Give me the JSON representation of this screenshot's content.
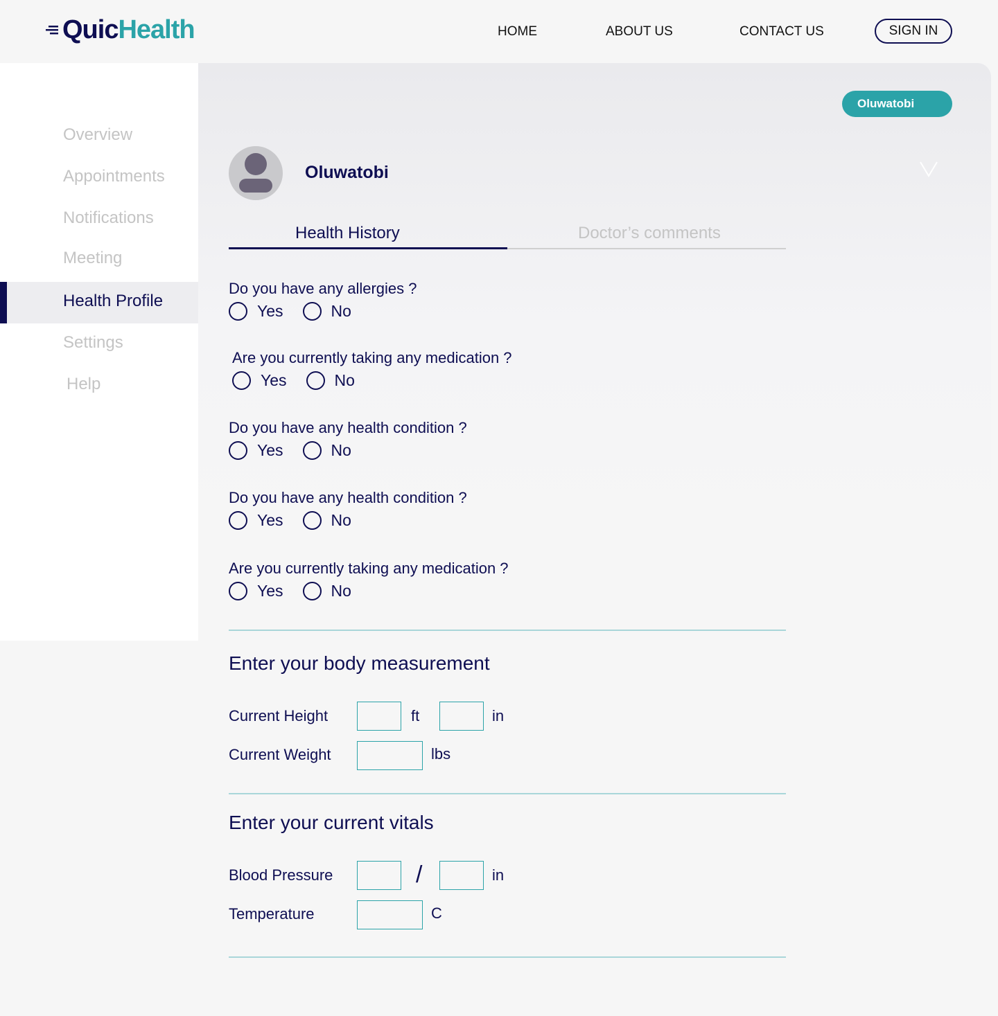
{
  "brand": {
    "quic": "Quic",
    "health": "Health"
  },
  "nav": {
    "home": "HOME",
    "about": "ABOUT US",
    "contact": "CONTACT US",
    "signin": "SIGN IN"
  },
  "sidebar": {
    "items": [
      "Overview",
      "Appointments",
      "Notifications",
      "Meeting",
      "Health Profile",
      "Settings",
      "Help"
    ],
    "active": "Health Profile"
  },
  "user": {
    "pill": "Oluwatobi",
    "name": "Oluwatobi"
  },
  "tabs": {
    "history": "Health History",
    "comments": "Doctor’s comments"
  },
  "questions": [
    {
      "text": "Do you have any allergies ?",
      "yes": "Yes",
      "no": "No"
    },
    {
      "text": "Are you currently taking any medication ?",
      "yes": "Yes",
      "no": "No"
    },
    {
      "text": "Do you have any health condition ?",
      "yes": "Yes",
      "no": "No"
    },
    {
      "text": "Do you have any health condition ?",
      "yes": "Yes",
      "no": "No"
    },
    {
      "text": "Are you currently taking any medication ?",
      "yes": "Yes",
      "no": "No"
    }
  ],
  "body_measurement": {
    "title": "Enter your body measurement",
    "height_label": "Current Height",
    "height_unit_ft": "ft",
    "height_unit_in": "in",
    "weight_label": "Current Weight",
    "weight_unit": "lbs"
  },
  "vitals": {
    "title": "Enter your current vitals",
    "bp_label": "Blood Pressure",
    "bp_separator": "/",
    "bp_unit": "in",
    "temp_label": "Temperature",
    "temp_unit": "C"
  },
  "colors": {
    "navy": "#0e0e52",
    "teal": "#2ba3a8",
    "muted": "#c4c4c4"
  }
}
